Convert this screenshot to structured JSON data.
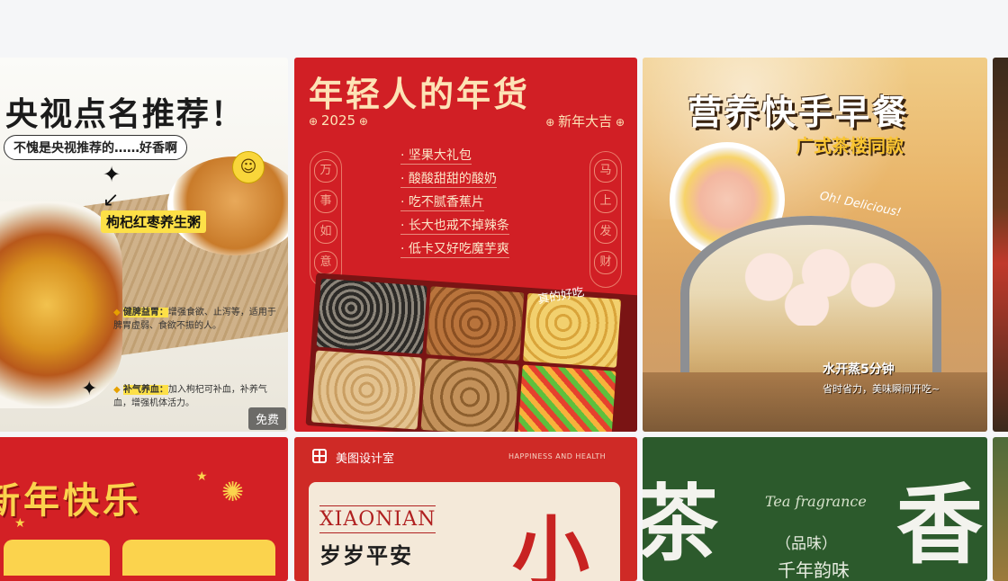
{
  "cards": {
    "cctv": {
      "title": "央视点名推荐！",
      "subtitle": "不愧是央视推荐的……好香啊",
      "label": "枸杞红枣养生粥",
      "bullet1_head": "健脾益胃：",
      "bullet1_body": "增强食欲、止泻等，适用于脾胃虚弱、食欲不振的人。",
      "bullet2_head": "补气养血：",
      "bullet2_body": "加入枸杞可补血，补养气血，增强机体活力。",
      "badge": "免费"
    },
    "nianhuo": {
      "title": "年轻人的年货",
      "year": "2025",
      "greeting": "新年大吉",
      "items": [
        "坚果大礼包",
        "酸酸甜甜的酸奶",
        "吃不腻香蕉片",
        "长大也戒不掉辣条",
        "低卡又好吃魔芋爽"
      ],
      "left_vertical": [
        "万",
        "事",
        "如",
        "意"
      ],
      "right_vertical": [
        "马",
        "上",
        "发",
        "财"
      ],
      "tag": "真的好吃"
    },
    "breakfast": {
      "title": "营养快手早餐",
      "subtitle": "广式茶楼同款",
      "oh": "Oh! Delicious!",
      "steam": "水开蒸5分钟",
      "steam_sub": "省时省力，美味瞬间开吃~"
    },
    "newyear": {
      "title": "新年快乐"
    },
    "xiaonian": {
      "brand": "美图设计室",
      "motto": "HAPPINESS AND HEALTH",
      "en": "XIAONIAN",
      "cn": "岁岁平安",
      "big": "小"
    },
    "tea": {
      "big1": "茶",
      "big2": "香",
      "en": "Tea fragrance",
      "pin": "（品味）",
      "line": "千年韵味"
    }
  },
  "colors": {
    "page_bg": "#f5f6f8",
    "festive_red": "#d21f24",
    "gold": "#f4c542",
    "tea_green": "#2c5a2c"
  }
}
